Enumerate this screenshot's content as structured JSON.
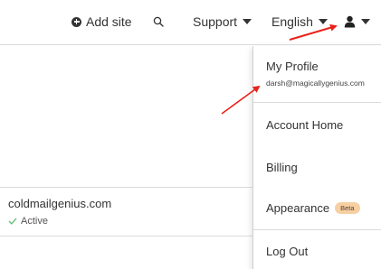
{
  "header": {
    "add_site_label": "Add site",
    "support_label": "Support",
    "language_label": "English"
  },
  "site": {
    "domain": "coldmailgenius.com",
    "status": "Active"
  },
  "user_menu": {
    "profile_title": "My Profile",
    "email": "darsh@magicallygenius.com",
    "items": [
      {
        "label": "Account Home"
      },
      {
        "label": "Billing"
      },
      {
        "label": "Appearance",
        "badge": "Beta"
      },
      {
        "label": "Log Out"
      }
    ]
  },
  "icons": {
    "add": "plus-circle-icon",
    "search": "search-icon",
    "support_caret": "caret-down-icon",
    "language_caret": "caret-down-icon",
    "user": "user-icon",
    "user_caret": "caret-down-icon",
    "status": "check-icon"
  },
  "colors": {
    "annotation_arrow": "#e8231b",
    "beta_badge": "#f6cfa3",
    "active_check": "#6fc27a"
  }
}
